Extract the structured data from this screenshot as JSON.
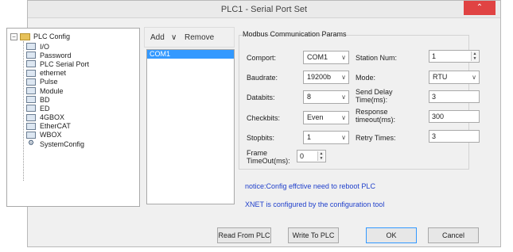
{
  "window": {
    "title": "PLC1 - Serial Port  Set",
    "close_glyph": "⌃"
  },
  "tree": {
    "root_label": "PLC Config",
    "expander": "−",
    "items": [
      {
        "label": "I/O",
        "icon": "io-icon"
      },
      {
        "label": "Password",
        "icon": "password-icon"
      },
      {
        "label": "PLC Serial Port",
        "icon": "serial-port-icon"
      },
      {
        "label": "ethernet",
        "icon": "ethernet-icon"
      },
      {
        "label": "Pulse",
        "icon": "pulse-icon"
      },
      {
        "label": "Module",
        "icon": "module-icon"
      },
      {
        "label": "BD",
        "icon": "bd-icon"
      },
      {
        "label": "ED",
        "icon": "ed-icon"
      },
      {
        "label": "4GBOX",
        "icon": "4gbox-icon"
      },
      {
        "label": "EtherCAT",
        "icon": "ethercat-icon"
      },
      {
        "label": "WBOX",
        "icon": "wbox-icon"
      },
      {
        "label": "SystemConfig",
        "icon": "gear-icon"
      }
    ]
  },
  "ports": {
    "add_label": "Add",
    "remove_label": "Remove",
    "items": [
      "COM1"
    ]
  },
  "params": {
    "group_title": "Modbus Communication Params",
    "comport": {
      "label": "Comport:",
      "value": "COM1"
    },
    "baudrate": {
      "label": "Baudrate:",
      "value": "19200b"
    },
    "databits": {
      "label": "Databits:",
      "value": "8"
    },
    "checkbits": {
      "label": "Checkbits:",
      "value": "Even"
    },
    "stopbits": {
      "label": "Stopbits:",
      "value": "1"
    },
    "frame_timeout": {
      "label_line1": "Frame",
      "label_line2": "TimeOut(ms):",
      "value": "0"
    },
    "station_num": {
      "label": "Station Num:",
      "value": "1"
    },
    "mode": {
      "label": "Mode:",
      "value": "RTU"
    },
    "send_delay": {
      "label_line1": "Send Delay",
      "label_line2": "Time(ms):",
      "value": "3"
    },
    "response_timeout": {
      "label_line1": "Response",
      "label_line2": "timeout(ms):",
      "value": "300"
    },
    "retry_times": {
      "label": "Retry Times:",
      "value": "3"
    }
  },
  "notices": {
    "line1": "notice:Config effctive need to reboot PLC",
    "line2": "XNET is configured by the configuration tool"
  },
  "buttons": {
    "read": "Read From PLC",
    "write": "Write To PLC",
    "ok": "OK",
    "cancel": "Cancel"
  },
  "glyphs": {
    "dropdown": "∨",
    "spin_up": "▲",
    "spin_down": "▼"
  },
  "colors": {
    "selection": "#3399ff",
    "notice": "#1f3fcb",
    "close": "#e04343"
  }
}
